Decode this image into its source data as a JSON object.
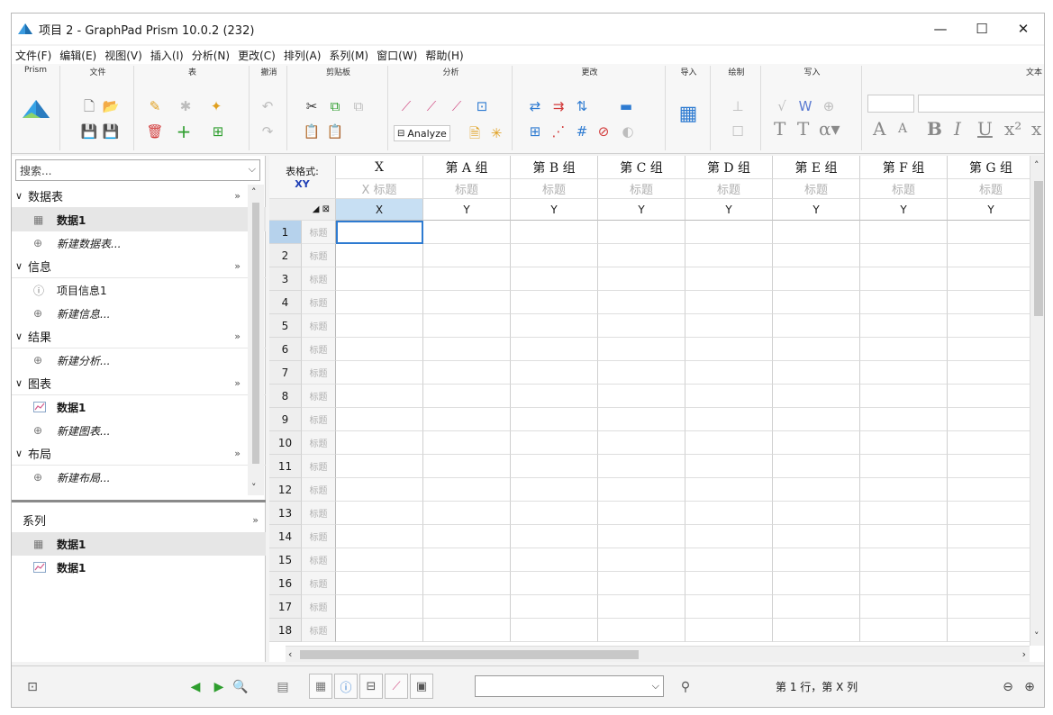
{
  "window": {
    "title": "项目 2 - GraphPad Prism 10.0.2 (232)",
    "minimize": "—",
    "maximize": "☐",
    "close": "✕"
  },
  "menu": [
    "文件(F)",
    "编辑(E)",
    "视图(V)",
    "插入(I)",
    "分析(N)",
    "更改(C)",
    "排列(A)",
    "系列(M)",
    "窗口(W)",
    "帮助(H)"
  ],
  "ribbon": {
    "groups": [
      "Prism",
      "文件",
      "表",
      "撤消",
      "剪贴板",
      "分析",
      "更改",
      "导入",
      "绘制",
      "写入",
      "文本"
    ],
    "analyze_label": "Analyze",
    "text_buttons": [
      "T",
      "T",
      "α▾",
      "A",
      "A",
      "B",
      "I",
      "U",
      "x²",
      "x"
    ]
  },
  "navigator": {
    "search_placeholder": "搜索...",
    "sections": [
      {
        "title": "数据表",
        "items": [
          {
            "label": "数据1",
            "style": "bold",
            "icon": "table-icon",
            "selected": true
          },
          {
            "label": "新建数据表...",
            "style": "italic",
            "icon": "add-icon"
          }
        ]
      },
      {
        "title": "信息",
        "items": [
          {
            "label": "项目信息1",
            "style": "normal",
            "icon": "info-icon"
          },
          {
            "label": "新建信息...",
            "style": "italic",
            "icon": "add-icon"
          }
        ]
      },
      {
        "title": "结果",
        "items": [
          {
            "label": "新建分析...",
            "style": "italic",
            "icon": "add-icon"
          }
        ]
      },
      {
        "title": "图表",
        "items": [
          {
            "label": "数据1",
            "style": "bold",
            "icon": "graph-icon"
          },
          {
            "label": "新建图表...",
            "style": "italic",
            "icon": "add-icon"
          }
        ]
      },
      {
        "title": "布局",
        "items": [
          {
            "label": "新建布局...",
            "style": "italic",
            "icon": "add-icon"
          }
        ]
      }
    ],
    "family": {
      "title": "系列",
      "items": [
        {
          "label": "数据1",
          "icon": "table-icon"
        },
        {
          "label": "数据1",
          "icon": "graph-icon"
        }
      ]
    }
  },
  "sheet": {
    "format_label": "表格式:",
    "format_value": "XY",
    "columns": [
      {
        "title": "X",
        "subtitle": "X 标题",
        "kind": "X"
      },
      {
        "title": "第 A 组",
        "subtitle": "标题",
        "kind": "Y"
      },
      {
        "title": "第 B 组",
        "subtitle": "标题",
        "kind": "Y"
      },
      {
        "title": "第 C 组",
        "subtitle": "标题",
        "kind": "Y"
      },
      {
        "title": "第 D 组",
        "subtitle": "标题",
        "kind": "Y"
      },
      {
        "title": "第 E 组",
        "subtitle": "标题",
        "kind": "Y"
      },
      {
        "title": "第 F 组",
        "subtitle": "标题",
        "kind": "Y"
      },
      {
        "title": "第 G 组",
        "subtitle": "标题",
        "kind": "Y"
      }
    ],
    "rows": [
      "1",
      "2",
      "3",
      "4",
      "5",
      "6",
      "7",
      "8",
      "9",
      "10",
      "11",
      "12",
      "13",
      "14",
      "15",
      "16",
      "17",
      "18"
    ],
    "row_title_placeholder": "标题"
  },
  "status": {
    "position": "第 1 行，第 X 列"
  },
  "colors": {
    "selection": "#c7dff3",
    "accent": "#2e7bd1",
    "nav_green": "#2e9e2e"
  }
}
